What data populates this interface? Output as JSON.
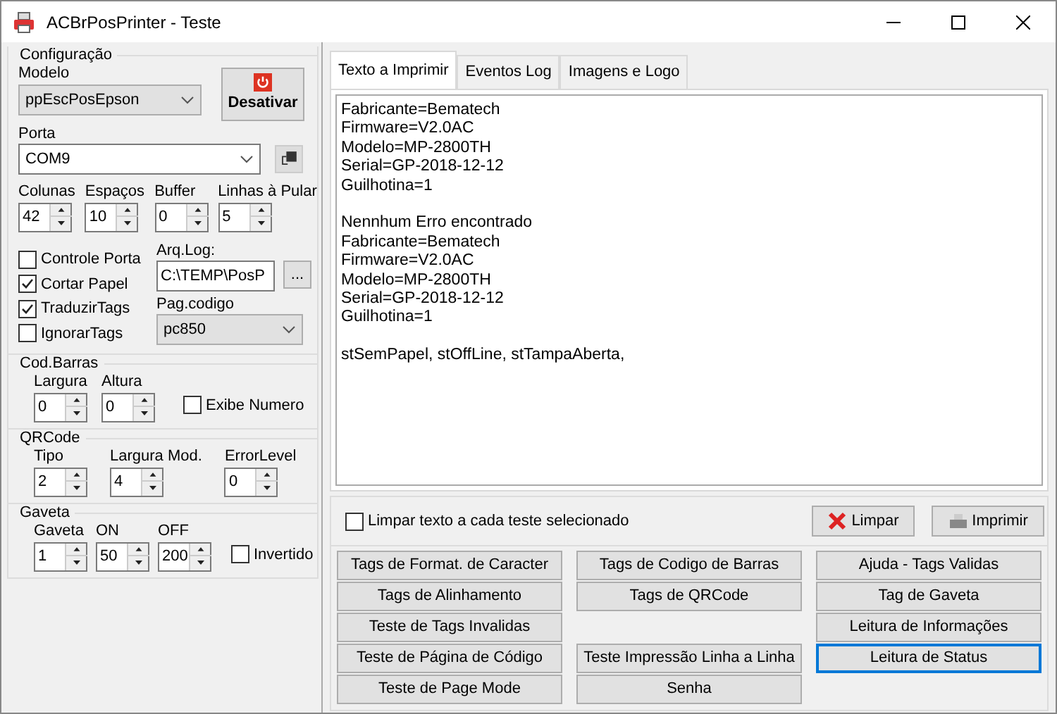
{
  "window": {
    "title": "ACBrPosPrinter - Teste"
  },
  "config": {
    "title": "Configuração",
    "modelo": {
      "label": "Modelo",
      "value": "ppEscPosEpson"
    },
    "desativar": "Desativar",
    "porta": {
      "label": "Porta",
      "value": "COM9"
    },
    "spins": [
      {
        "label": "Colunas",
        "value": "42"
      },
      {
        "label": "Espaços",
        "value": "10"
      },
      {
        "label": "Buffer",
        "value": "0"
      },
      {
        "label": "Linhas à Pular",
        "value": "5"
      }
    ],
    "checks": [
      {
        "label": "Controle Porta",
        "checked": false
      },
      {
        "label": "Cortar Papel",
        "checked": true
      },
      {
        "label": "TraduzirTags",
        "checked": true
      },
      {
        "label": "IgnorarTags",
        "checked": false
      }
    ],
    "arq_log": {
      "label": "Arq.Log:",
      "value": "C:\\TEMP\\PosP",
      "button": "..."
    },
    "pag_codigo": {
      "label": "Pag.codigo",
      "value": "pc850"
    }
  },
  "cod_barras": {
    "title": "Cod.Barras",
    "spins": [
      {
        "label": "Largura",
        "value": "0"
      },
      {
        "label": "Altura",
        "value": "0"
      }
    ],
    "check": {
      "label": "Exibe Numero",
      "checked": false
    }
  },
  "qrcode": {
    "title": "QRCode",
    "spins": [
      {
        "label": "Tipo",
        "value": "2"
      },
      {
        "label": "Largura Mod.",
        "value": "4"
      },
      {
        "label": "ErrorLevel",
        "value": "0"
      }
    ]
  },
  "gaveta": {
    "title": "Gaveta",
    "spins": [
      {
        "label": "Gaveta",
        "value": "1"
      },
      {
        "label": "ON",
        "value": "50"
      },
      {
        "label": "OFF",
        "value": "200"
      }
    ],
    "check": {
      "label": "Invertido",
      "checked": false
    }
  },
  "tabs": [
    {
      "label": "Texto a Imprimir",
      "selected": true
    },
    {
      "label": "Eventos Log",
      "selected": false
    },
    {
      "label": "Imagens e Logo",
      "selected": false
    }
  ],
  "memo": [
    [
      "Fabricante=Bematech",
      "Firmware=V2.0AC",
      "Modelo=MP-2800TH",
      "Serial=GP-2018-12-12",
      "Guilhotina=1"
    ],
    [
      "Nennhum Erro encontrado",
      "Fabricante=Bematech",
      "Firmware=V2.0AC",
      "Modelo=MP-2800TH",
      "Serial=GP-2018-12-12",
      "Guilhotina=1"
    ],
    [
      "stSemPapel, stOffLine, stTampaAberta,"
    ]
  ],
  "limpar_check": {
    "label": "Limpar texto a cada teste selecionado",
    "checked": false
  },
  "limpar": "Limpar",
  "imprimir": "Imprimir",
  "button_rows": [
    [
      {
        "label": "Tags de Format. de Caracter",
        "focused": false
      },
      {
        "label": "Tags de Codigo de Barras",
        "focused": false
      },
      {
        "label": "Ajuda - Tags Validas",
        "focused": false
      }
    ],
    [
      {
        "label": "Tags de Alinhamento",
        "focused": false
      },
      {
        "label": "Tags de QRCode",
        "focused": false
      },
      {
        "label": "Tag de Gaveta",
        "focused": false
      }
    ],
    [
      {
        "label": "Teste de Tags Invalidas",
        "focused": false
      },
      null,
      {
        "label": "Leitura de Informações",
        "focused": false
      }
    ],
    [
      {
        "label": "Teste de Página de Código",
        "focused": false
      },
      {
        "label": "Teste Impressão Linha a Linha",
        "focused": false
      },
      {
        "label": "Leitura de Status",
        "focused": true
      }
    ],
    [
      {
        "label": "Teste de Page Mode",
        "focused": false
      },
      {
        "label": "Senha",
        "focused": false
      },
      null
    ]
  ]
}
